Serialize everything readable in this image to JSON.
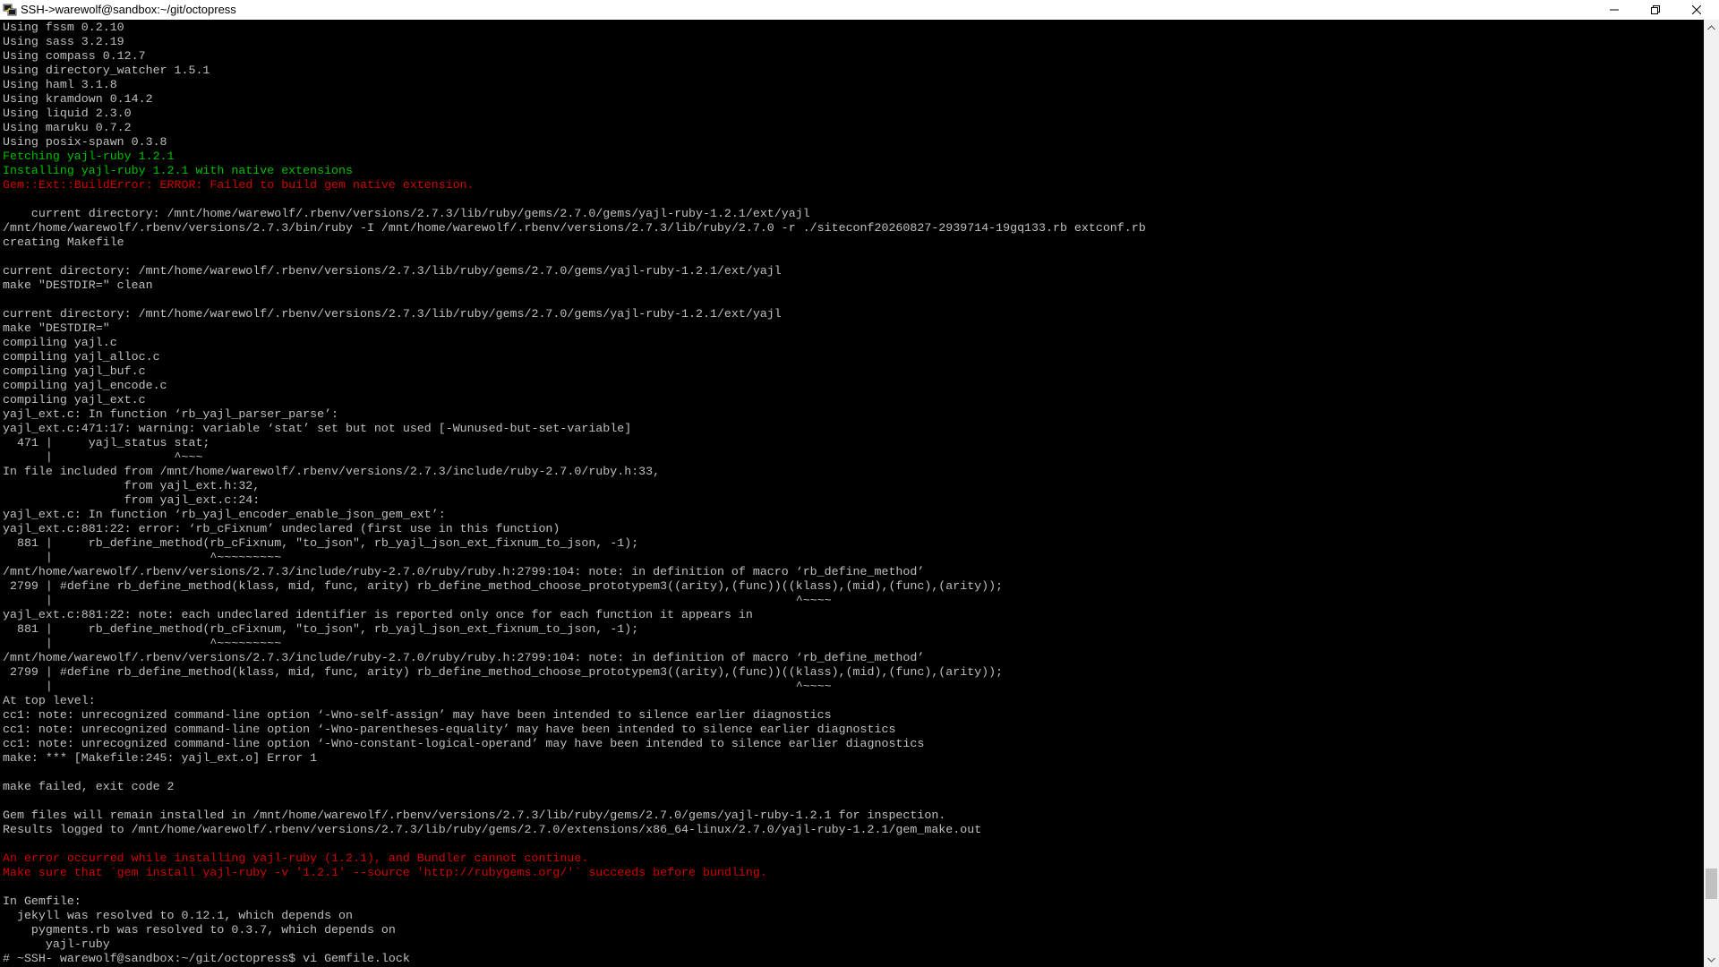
{
  "window": {
    "title": "SSH->warewolf@sandbox:~/git/octopress",
    "minimize_icon": "minimize-icon",
    "restore_icon": "restore-icon",
    "close_icon": "close-icon",
    "app_icon": "putty-terminal-icon"
  },
  "colors": {
    "background": "#000000",
    "text": "#c0c0c0",
    "success": "#00c000",
    "error": "#d00000"
  },
  "terminal": {
    "lines": [
      {
        "text": "Using fssm 0.2.10",
        "style": "normal"
      },
      {
        "text": "Using sass 3.2.19",
        "style": "normal"
      },
      {
        "text": "Using compass 0.12.7",
        "style": "normal"
      },
      {
        "text": "Using directory_watcher 1.5.1",
        "style": "normal"
      },
      {
        "text": "Using haml 3.1.8",
        "style": "normal"
      },
      {
        "text": "Using kramdown 0.14.2",
        "style": "normal"
      },
      {
        "text": "Using liquid 2.3.0",
        "style": "normal"
      },
      {
        "text": "Using maruku 0.7.2",
        "style": "normal"
      },
      {
        "text": "Using posix-spawn 0.3.8",
        "style": "normal"
      },
      {
        "text": "Fetching yajl-ruby 1.2.1",
        "style": "green"
      },
      {
        "text": "Installing yajl-ruby 1.2.1 with native extensions",
        "style": "green"
      },
      {
        "text": "Gem::Ext::BuildError: ERROR: Failed to build gem native extension.",
        "style": "red"
      },
      {
        "text": "",
        "style": "normal"
      },
      {
        "text": "    current directory: /mnt/home/warewolf/.rbenv/versions/2.7.3/lib/ruby/gems/2.7.0/gems/yajl-ruby-1.2.1/ext/yajl",
        "style": "normal"
      },
      {
        "text": "/mnt/home/warewolf/.rbenv/versions/2.7.3/bin/ruby -I /mnt/home/warewolf/.rbenv/versions/2.7.3/lib/ruby/2.7.0 -r ./siteconf20260827-2939714-19gq133.rb extconf.rb",
        "style": "normal"
      },
      {
        "text": "creating Makefile",
        "style": "normal"
      },
      {
        "text": "",
        "style": "normal"
      },
      {
        "text": "current directory: /mnt/home/warewolf/.rbenv/versions/2.7.3/lib/ruby/gems/2.7.0/gems/yajl-ruby-1.2.1/ext/yajl",
        "style": "normal"
      },
      {
        "text": "make \"DESTDIR=\" clean",
        "style": "normal"
      },
      {
        "text": "",
        "style": "normal"
      },
      {
        "text": "current directory: /mnt/home/warewolf/.rbenv/versions/2.7.3/lib/ruby/gems/2.7.0/gems/yajl-ruby-1.2.1/ext/yajl",
        "style": "normal"
      },
      {
        "text": "make \"DESTDIR=\"",
        "style": "normal"
      },
      {
        "text": "compiling yajl.c",
        "style": "normal"
      },
      {
        "text": "compiling yajl_alloc.c",
        "style": "normal"
      },
      {
        "text": "compiling yajl_buf.c",
        "style": "normal"
      },
      {
        "text": "compiling yajl_encode.c",
        "style": "normal"
      },
      {
        "text": "compiling yajl_ext.c",
        "style": "normal"
      },
      {
        "text": "yajl_ext.c: In function ‘rb_yajl_parser_parse’:",
        "style": "normal"
      },
      {
        "text": "yajl_ext.c:471:17: warning: variable ‘stat’ set but not used [-Wunused-but-set-variable]",
        "style": "normal"
      },
      {
        "text": "  471 |     yajl_status stat;",
        "style": "normal"
      },
      {
        "text": "      |                 ^~~~",
        "style": "normal"
      },
      {
        "text": "In file included from /mnt/home/warewolf/.rbenv/versions/2.7.3/include/ruby-2.7.0/ruby.h:33,",
        "style": "normal"
      },
      {
        "text": "                 from yajl_ext.h:32,",
        "style": "normal"
      },
      {
        "text": "                 from yajl_ext.c:24:",
        "style": "normal"
      },
      {
        "text": "yajl_ext.c: In function ‘rb_yajl_encoder_enable_json_gem_ext’:",
        "style": "normal"
      },
      {
        "text": "yajl_ext.c:881:22: error: ‘rb_cFixnum’ undeclared (first use in this function)",
        "style": "normal"
      },
      {
        "text": "  881 |     rb_define_method(rb_cFixnum, \"to_json\", rb_yajl_json_ext_fixnum_to_json, -1);",
        "style": "normal"
      },
      {
        "text": "      |                      ^~~~~~~~~~",
        "style": "normal"
      },
      {
        "text": "/mnt/home/warewolf/.rbenv/versions/2.7.3/include/ruby-2.7.0/ruby/ruby.h:2799:104: note: in definition of macro ‘rb_define_method’",
        "style": "normal"
      },
      {
        "text": " 2799 | #define rb_define_method(klass, mid, func, arity) rb_define_method_choose_prototypem3((arity),(func))((klass),(mid),(func),(arity));",
        "style": "normal"
      },
      {
        "text": "      |                                                                                                        ^~~~~",
        "style": "normal"
      },
      {
        "text": "yajl_ext.c:881:22: note: each undeclared identifier is reported only once for each function it appears in",
        "style": "normal"
      },
      {
        "text": "  881 |     rb_define_method(rb_cFixnum, \"to_json\", rb_yajl_json_ext_fixnum_to_json, -1);",
        "style": "normal"
      },
      {
        "text": "      |                      ^~~~~~~~~~",
        "style": "normal"
      },
      {
        "text": "/mnt/home/warewolf/.rbenv/versions/2.7.3/include/ruby-2.7.0/ruby/ruby.h:2799:104: note: in definition of macro ‘rb_define_method’",
        "style": "normal"
      },
      {
        "text": " 2799 | #define rb_define_method(klass, mid, func, arity) rb_define_method_choose_prototypem3((arity),(func))((klass),(mid),(func),(arity));",
        "style": "normal"
      },
      {
        "text": "      |                                                                                                        ^~~~~",
        "style": "normal"
      },
      {
        "text": "At top level:",
        "style": "normal"
      },
      {
        "text": "cc1: note: unrecognized command-line option ‘-Wno-self-assign’ may have been intended to silence earlier diagnostics",
        "style": "normal"
      },
      {
        "text": "cc1: note: unrecognized command-line option ‘-Wno-parentheses-equality’ may have been intended to silence earlier diagnostics",
        "style": "normal"
      },
      {
        "text": "cc1: note: unrecognized command-line option ‘-Wno-constant-logical-operand’ may have been intended to silence earlier diagnostics",
        "style": "normal"
      },
      {
        "text": "make: *** [Makefile:245: yajl_ext.o] Error 1",
        "style": "normal"
      },
      {
        "text": "",
        "style": "normal"
      },
      {
        "text": "make failed, exit code 2",
        "style": "normal"
      },
      {
        "text": "",
        "style": "normal"
      },
      {
        "text": "Gem files will remain installed in /mnt/home/warewolf/.rbenv/versions/2.7.3/lib/ruby/gems/2.7.0/gems/yajl-ruby-1.2.1 for inspection.",
        "style": "normal"
      },
      {
        "text": "Results logged to /mnt/home/warewolf/.rbenv/versions/2.7.3/lib/ruby/gems/2.7.0/extensions/x86_64-linux/2.7.0/yajl-ruby-1.2.1/gem_make.out",
        "style": "normal"
      },
      {
        "text": "",
        "style": "normal"
      },
      {
        "text": "An error occurred while installing yajl-ruby (1.2.1), and Bundler cannot continue.",
        "style": "red"
      },
      {
        "text": "Make sure that `gem install yajl-ruby -v '1.2.1' --source 'http://rubygems.org/'` succeeds before bundling.",
        "style": "red"
      },
      {
        "text": "",
        "style": "normal"
      },
      {
        "text": "In Gemfile:",
        "style": "normal"
      },
      {
        "text": "  jekyll was resolved to 0.12.1, which depends on",
        "style": "normal"
      },
      {
        "text": "    pygments.rb was resolved to 0.3.7, which depends on",
        "style": "normal"
      },
      {
        "text": "      yajl-ruby",
        "style": "normal"
      },
      {
        "text": "# ~SSH- warewolf@sandbox:~/git/octopress$ vi Gemfile.lock",
        "style": "normal"
      }
    ]
  },
  "scrollbar": {
    "up_icon": "scroll-up-arrow-icon",
    "down_icon": "scroll-down-arrow-icon",
    "position_fraction": 0.94
  }
}
